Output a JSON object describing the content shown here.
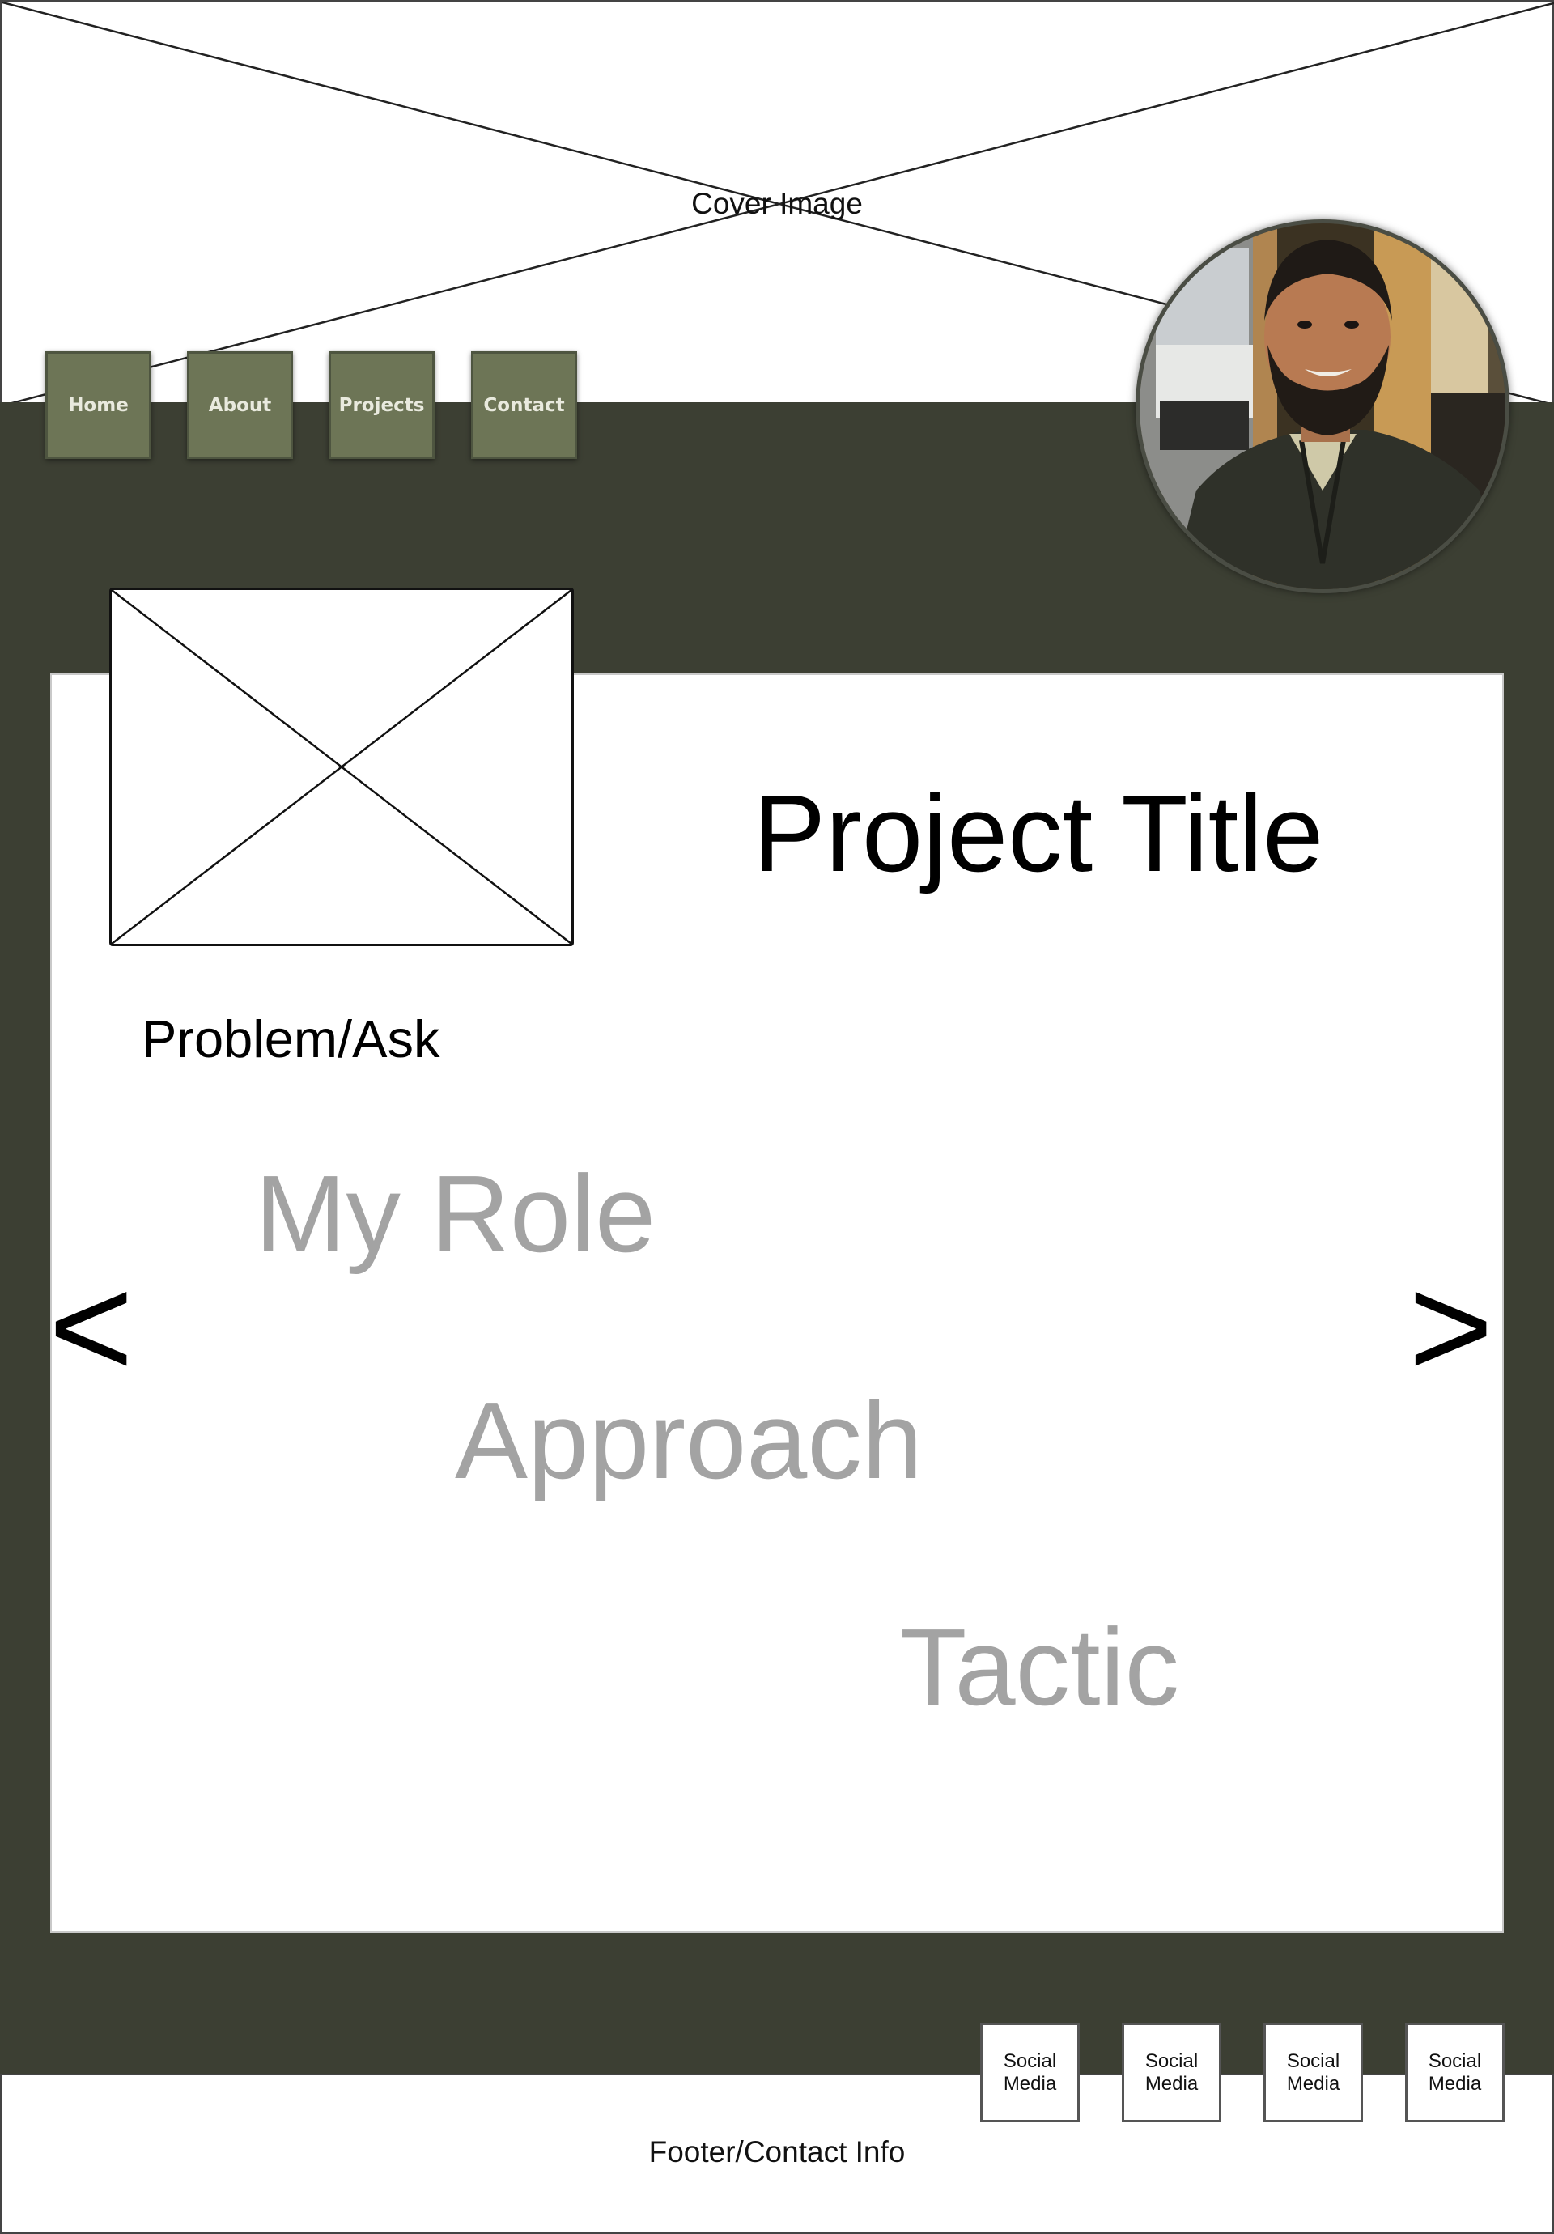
{
  "cover": {
    "label": "Cover Image"
  },
  "nav": {
    "items": [
      {
        "label": "Home"
      },
      {
        "label": "About"
      },
      {
        "label": "Projects"
      },
      {
        "label": "Contact"
      }
    ]
  },
  "project": {
    "title": "Project Title",
    "problem_label": "Problem/Ask",
    "steps": [
      {
        "label": "My Role"
      },
      {
        "label": "Approach"
      },
      {
        "label": "Tactic"
      }
    ],
    "prev_glyph": "<",
    "next_glyph": ">"
  },
  "social": {
    "items": [
      {
        "label": "Social Media"
      },
      {
        "label": "Social Media"
      },
      {
        "label": "Social Media"
      },
      {
        "label": "Social Media"
      }
    ]
  },
  "footer": {
    "label": "Footer/Contact Info"
  },
  "colors": {
    "band": "#3c3f33",
    "nav_button": "#6d7556",
    "nav_text": "#e9eade",
    "step_text": "#a3a3a3"
  }
}
